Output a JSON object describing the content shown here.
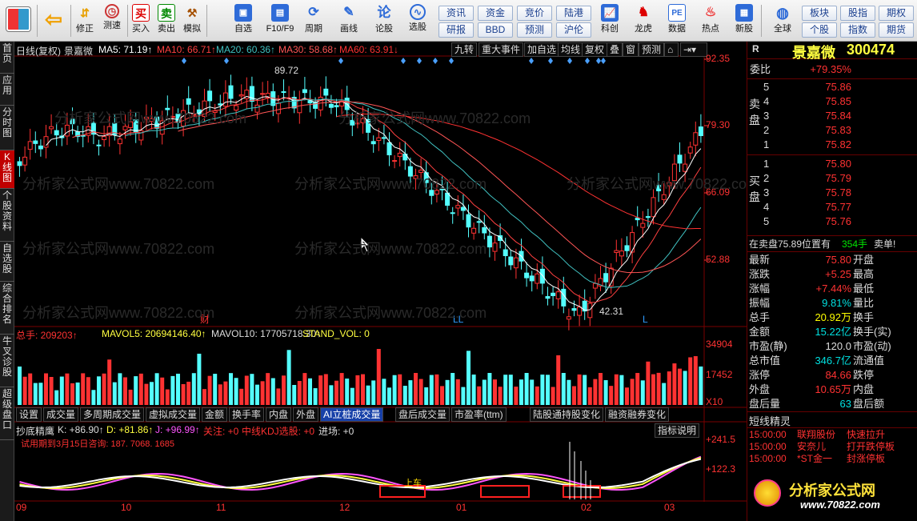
{
  "toolbar": {
    "buttons": [
      {
        "label": "修正",
        "icon": "up-down-arrows-icon"
      },
      {
        "label": "测速",
        "icon": "clock-icon"
      },
      {
        "label": "买入",
        "icon": "buy-icon",
        "glyph": "买"
      },
      {
        "label": "卖出",
        "icon": "sell-icon",
        "glyph": "卖"
      },
      {
        "label": "模拟",
        "icon": "hammer-icon"
      },
      {
        "label": "自选",
        "icon": "folder-icon"
      },
      {
        "label": "F10/F9",
        "icon": "f10-icon"
      },
      {
        "label": "周期",
        "icon": "period-icon"
      },
      {
        "label": "画线",
        "icon": "pen-icon"
      },
      {
        "label": "论股",
        "icon": "discuss-icon",
        "glyph": "论"
      },
      {
        "label": "选股",
        "icon": "select-stock-icon"
      },
      {
        "label": "科创",
        "icon": "sci-tech-icon"
      },
      {
        "label": "龙虎",
        "icon": "dragon-tiger-icon"
      },
      {
        "label": "数据",
        "icon": "data-pe-icon",
        "glyph": "PE"
      },
      {
        "label": "热点",
        "icon": "fire-icon"
      },
      {
        "label": "新股",
        "icon": "new-stock-icon"
      },
      {
        "label": "全球",
        "icon": "globe-icon"
      }
    ],
    "small_buttons": [
      "资讯",
      "资金",
      "竞价",
      "陆港",
      "研报",
      "BBD",
      "预测",
      "沪伦",
      "板块",
      "股指",
      "期权",
      "个股",
      "指数",
      "期货"
    ]
  },
  "left_tabs": [
    {
      "label": "首页",
      "active": false
    },
    {
      "label": "应用",
      "active": false
    },
    {
      "label": "分时图",
      "active": false
    },
    {
      "label": "K线图",
      "active": true
    },
    {
      "label": "个股资料",
      "active": false
    },
    {
      "label": "自选股",
      "active": false
    },
    {
      "label": "综合排名",
      "active": false
    },
    {
      "label": "牛叉诊股",
      "active": false
    },
    {
      "label": "超级盘口",
      "active": false
    }
  ],
  "kline": {
    "header_prefix": "日线(复权)",
    "stock_name": "景嘉微",
    "ma": [
      {
        "label": "MA5: 71.19↑",
        "color": "#ffffff"
      },
      {
        "label": "MA10: 66.71↑",
        "color": "#ff4040"
      },
      {
        "label": "MA20: 60.36↑",
        "color": "#40c0c0"
      },
      {
        "label": "MA30: 58.68↑",
        "color": "#ff5555"
      },
      {
        "label": "MA60: 63.91↓",
        "color": "#ff3232"
      }
    ],
    "chart_buttons": [
      "九转",
      "重大事件",
      "加自选",
      "均线",
      "复权",
      "叠",
      "窗",
      "预测"
    ],
    "price_axis": [
      "92.35",
      "79.30",
      "66.09",
      "52.88"
    ],
    "high_label": "89.72",
    "low_label": "42.31",
    "marks": [
      "财",
      "LL",
      "L"
    ],
    "watermark": "分析家公式网www.70822.com"
  },
  "volume": {
    "label_total": "总手: 209203↑",
    "mavol5": "MAVOL5: 20694146.40↑",
    "mavol10": "MAVOL10: 17705718.30↑",
    "stand": "STAND_VOL: 0",
    "axis": [
      "34904",
      "17452",
      "X10"
    ]
  },
  "indicator_tabs": [
    {
      "label": "设置",
      "active": false
    },
    {
      "label": "成交量",
      "active": false
    },
    {
      "label": "多周期成交量",
      "active": false
    },
    {
      "label": "虚拟成交量",
      "active": false
    },
    {
      "label": "金额",
      "active": false
    },
    {
      "label": "换手率",
      "active": false
    },
    {
      "label": "内盘",
      "active": false
    },
    {
      "label": "外盘",
      "active": false
    },
    {
      "label": "AI立桩成交量",
      "active": true
    },
    {
      "label": "盘后成交量",
      "active": false
    },
    {
      "label": "市盈率(ttm)",
      "active": false
    },
    {
      "label": "陆股通持股变化",
      "active": false
    },
    {
      "label": "融资融券变化",
      "active": false
    }
  ],
  "kdj": {
    "name": "抄底精鹰",
    "k": "K: +86.90↑",
    "d": "D: +81.86↑",
    "j": "J: +96.99↑",
    "guanzhu": "关注: +0",
    "zhong": "中线KDJ选股: +0",
    "jinchang": "进场: +0",
    "trial": "试用期到3月15日咨询: 187. 7068. 1685",
    "help": "指标说明",
    "axis": [
      "+241.5",
      "+122.3"
    ],
    "car_label": "上车"
  },
  "date_axis": [
    "09",
    "10",
    "11",
    "12",
    "01",
    "02",
    "03"
  ],
  "right_panel": {
    "code_prefix": "R",
    "name": "景嘉微",
    "code": "300474",
    "weibi_label": "委比",
    "weibi": "+79.35%",
    "sell_label": "卖盘",
    "buy_label": "买盘",
    "sell": [
      {
        "lvl": "5",
        "price": "75.86"
      },
      {
        "lvl": "4",
        "price": "75.85"
      },
      {
        "lvl": "3",
        "price": "75.84"
      },
      {
        "lvl": "2",
        "price": "75.83"
      },
      {
        "lvl": "1",
        "price": "75.82"
      }
    ],
    "buy": [
      {
        "lvl": "1",
        "price": "75.80"
      },
      {
        "lvl": "2",
        "price": "75.79"
      },
      {
        "lvl": "3",
        "price": "75.78"
      },
      {
        "lvl": "4",
        "price": "75.77"
      },
      {
        "lvl": "5",
        "price": "75.76"
      }
    ],
    "trade_note": "在卖盘75.89位置有",
    "trade_qty": "354手",
    "trade_tag": "卖单!",
    "stats": [
      {
        "k": "最新",
        "v": "75.80",
        "vc": "red",
        "k2": "开盘"
      },
      {
        "k": "涨跌",
        "v": "+5.25",
        "vc": "red",
        "k2": "最高"
      },
      {
        "k": "涨幅",
        "v": "+7.44%",
        "vc": "red",
        "k2": "最低"
      },
      {
        "k": "振幅",
        "v": "9.81%",
        "vc": "cyan",
        "k2": "量比"
      },
      {
        "k": "总手",
        "v": "20.92万",
        "vc": "yel",
        "k2": "换手"
      },
      {
        "k": "金额",
        "v": "15.22亿",
        "vc": "cyan",
        "k2": "换手(实)"
      },
      {
        "k": "市盈(静)",
        "v": "120.0",
        "vc": "wht",
        "k2": "市盈(动)"
      },
      {
        "k": "总市值",
        "v": "346.7亿",
        "vc": "cyan",
        "k2": "流通值"
      },
      {
        "k": "涨停",
        "v": "84.66",
        "vc": "red",
        "k2": "跌停"
      },
      {
        "k": "外盘",
        "v": "10.65万",
        "vc": "red",
        "k2": "内盘"
      },
      {
        "k": "盘后量",
        "v": "63",
        "vc": "cyan",
        "k2": "盘后额"
      }
    ],
    "short_title": "短线精灵",
    "short_rows": [
      {
        "time": "15:00:00",
        "name": "联翔股份",
        "event": "快速拉升"
      },
      {
        "time": "15:00:00",
        "name": "安奈儿",
        "event": "打开跌停板"
      },
      {
        "time": "15:00:00",
        "name": "*ST金一",
        "event": "封涨停板"
      }
    ],
    "logo_text": "分析家公式网",
    "logo_url": "www.70822.com"
  }
}
